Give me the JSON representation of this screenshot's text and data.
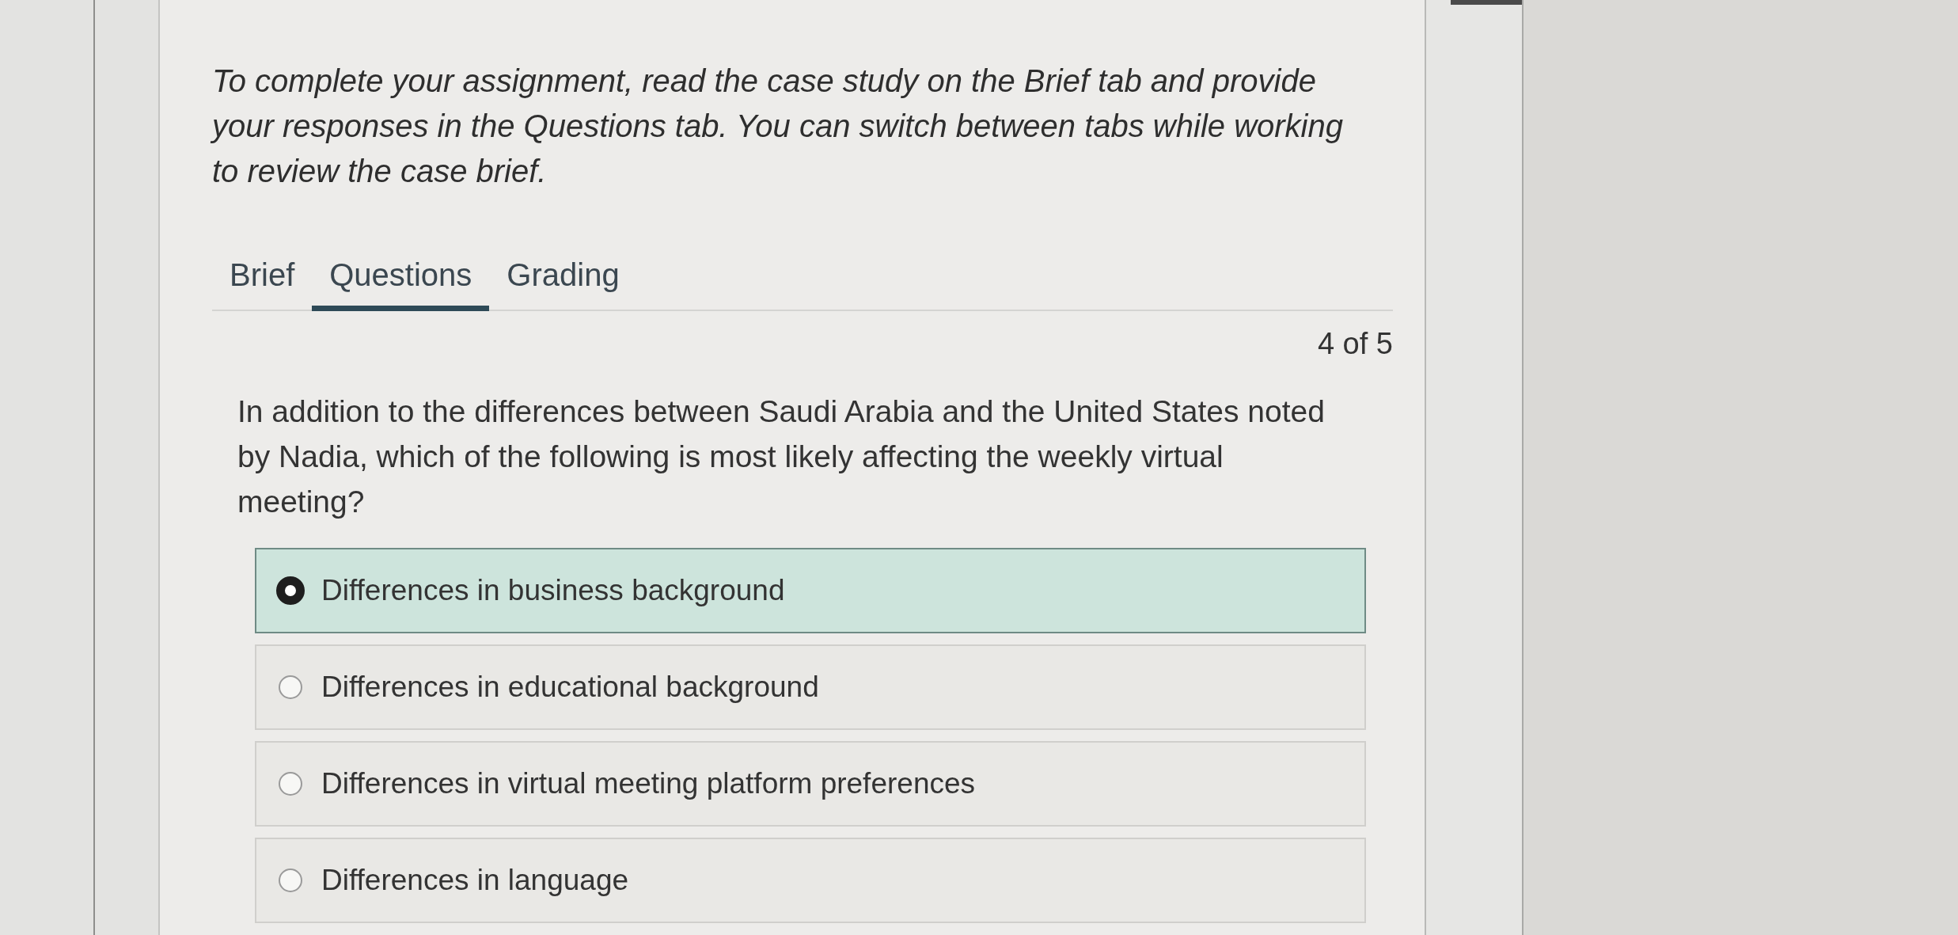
{
  "instructions": "To complete your assignment, read the case study on the Brief tab and provide your responses in the Questions tab. You can switch between tabs while working to review the case brief.",
  "tabs": [
    {
      "label": "Brief",
      "selected": false
    },
    {
      "label": "Questions",
      "selected": true
    },
    {
      "label": "Grading",
      "selected": false
    }
  ],
  "progress": "4 of 5",
  "question": {
    "text": "In addition to the differences between Saudi Arabia and the United States noted by Nadia, which of the following is most likely affecting the weekly virtual meeting?",
    "options": [
      {
        "label": "Differences in business background",
        "selected": true
      },
      {
        "label": "Differences in educational background",
        "selected": false
      },
      {
        "label": "Differences in virtual meeting platform preferences",
        "selected": false
      },
      {
        "label": "Differences in language",
        "selected": false
      }
    ]
  }
}
